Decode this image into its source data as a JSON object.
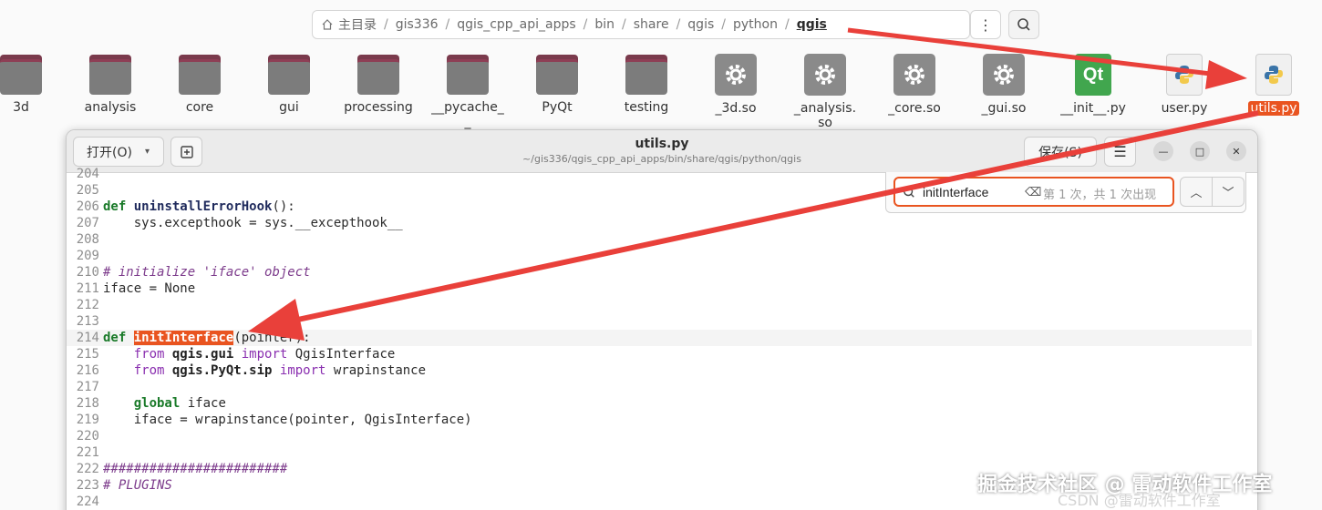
{
  "path_bar": {
    "crumbs": [
      "主目录",
      "gis336",
      "qgis_cpp_api_apps",
      "bin",
      "share",
      "qgis",
      "python",
      "qgis"
    ]
  },
  "files": [
    {
      "label": "3d",
      "type": "folder"
    },
    {
      "label": "analysis",
      "type": "folder"
    },
    {
      "label": "core",
      "type": "folder"
    },
    {
      "label": "gui",
      "type": "folder"
    },
    {
      "label": "processing",
      "type": "folder"
    },
    {
      "label": "__pycache_",
      "type": "folder"
    },
    {
      "label": "PyQt",
      "type": "folder"
    },
    {
      "label": "testing",
      "type": "folder"
    },
    {
      "label": "_3d.so",
      "type": "so"
    },
    {
      "label": "_analysis.",
      "type": "so"
    },
    {
      "label": "_core.so",
      "type": "so"
    },
    {
      "label": "_gui.so",
      "type": "so"
    },
    {
      "label": "__init__.py",
      "type": "qt"
    },
    {
      "label": "user.py",
      "type": "py"
    },
    {
      "label": "utils.py",
      "type": "py",
      "selected": true
    }
  ],
  "analysis_second_line": "so",
  "pycache_second_line": "_",
  "qt_icon_text": "Qt",
  "editor": {
    "open_label": "打开(O)",
    "title": "utils.py",
    "subtitle": "~/gis336/qgis_cpp_api_apps/bin/share/qgis/python/qgis",
    "save_label": "保存(S)"
  },
  "search": {
    "query": "initInterface",
    "result_text": "第 1 次，共 1 次出现"
  },
  "code": {
    "l204": "204",
    "l205": "205",
    "l206": "206",
    "kw_def": "def",
    "fn_uninstall": "uninstallErrorHook",
    "paren_colon": "():",
    "l207": "207",
    "c207": "    sys.excepthook = sys.__excepthook__",
    "l208": "208",
    "l209": "209",
    "l210": "210",
    "c210_a": "# initialize ",
    "c210_b": "'iface'",
    "c210_c": " object",
    "l211": "211",
    "c211": "iface = None",
    "l212": "212",
    "l213": "213",
    "l214": "214",
    "fn_init": "initInterface",
    "c214_rest": "(pointer):",
    "l215": "215",
    "kw_from": "from",
    "mod_gui": "qgis.gui",
    "kw_import": "import",
    "c215_rest": " QgisInterface",
    "l216": "216",
    "mod_sip": "qgis.PyQt.sip",
    "c216_rest": " wrapinstance",
    "l217": "217",
    "l218": "218",
    "kw_global": "global",
    "c218_rest": " iface",
    "l219": "219",
    "c219": "    iface = wrapinstance(pointer, QgisInterface)",
    "l220": "220",
    "l221": "221",
    "l222": "222",
    "c222": "########################",
    "l223": "223",
    "c223": "# PLUGINS",
    "l224": "224"
  },
  "watermark": "掘金技术社区 @ 雷动软件工作室",
  "watermark_bg": "CSDN @雷动软件工作室",
  "colors": {
    "accent": "#e95420",
    "arrow": "#e9403a"
  }
}
